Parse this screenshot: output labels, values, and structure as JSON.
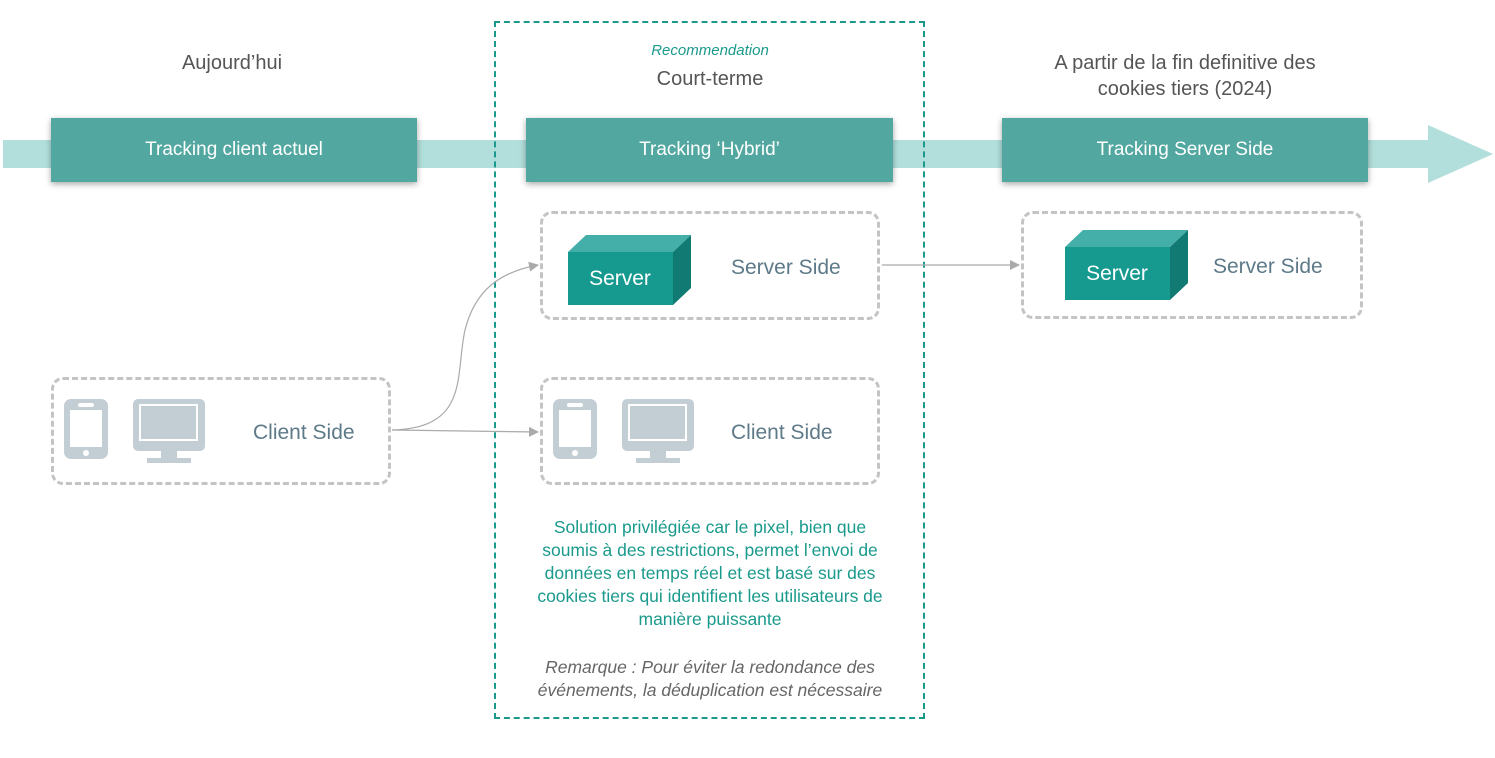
{
  "phases": [
    {
      "title": "Aujourd’hui",
      "stage_label": "Tracking client actuel"
    },
    {
      "tag": "Recommendation",
      "title": "Court-terme",
      "stage_label": "Tracking ‘Hybrid’"
    },
    {
      "title_line1": "A partir de la fin definitive des",
      "title_line2": "cookies tiers (2024)",
      "stage_label": "Tracking Server Side"
    }
  ],
  "boxes": {
    "client_today": {
      "label": "Client Side",
      "icons": [
        "smartphone-icon",
        "monitor-icon"
      ]
    },
    "server_hybrid": {
      "label": "Server Side",
      "server_text": "Server",
      "icon": "server-cube-icon"
    },
    "client_hybrid": {
      "label": "Client Side",
      "icons": [
        "smartphone-icon",
        "monitor-icon"
      ]
    },
    "server_future": {
      "label": "Server Side",
      "server_text": "Server",
      "icon": "server-cube-icon"
    }
  },
  "description": {
    "lines": [
      "Solution privilégiée car le pixel, bien que",
      "soumis à des restrictions, permet l’envoi de",
      "données en temps réel et est basé sur des",
      "cookies tiers qui identifient les utilisateurs de",
      "manière puissante"
    ]
  },
  "remark": {
    "lines": [
      "Remarque : Pour éviter la redondance des",
      "événements, la déduplication est nécessaire"
    ]
  },
  "colors": {
    "accent": "#1a9a8c",
    "stage": "#52a8a0",
    "timeline": "#b2dfdb",
    "server_front": "#169a90",
    "server_top": "#43afa8",
    "server_side": "#117a72",
    "device": "#c2ced3",
    "dash_gray": "#c4c4c4",
    "side_text": "#5e7a88"
  }
}
